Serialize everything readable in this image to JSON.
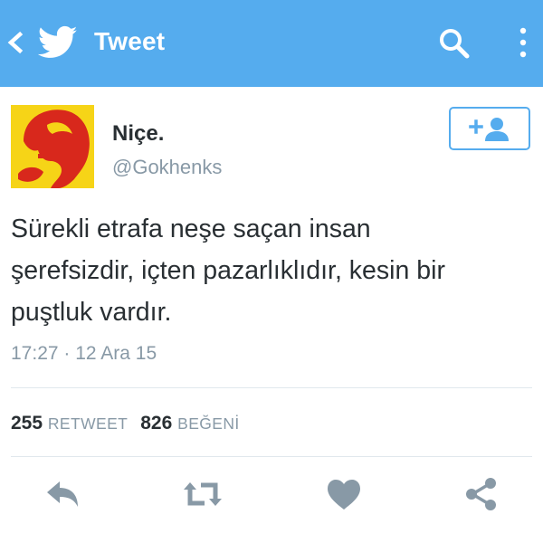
{
  "app_bar": {
    "title": "Tweet",
    "background": "#55acee",
    "icons": [
      "chevron-left-icon",
      "twitter-bird-icon",
      "search-icon",
      "overflow-menu-icon"
    ]
  },
  "author": {
    "name": "Niçe.",
    "handle": "@Gokhenks",
    "avatar_colors": {
      "background": "#f6d417",
      "figure": "#d8281c"
    }
  },
  "follow_button": {
    "icon": "follow-user-icon",
    "color": "#55acee"
  },
  "tweet": {
    "lines": [
      "Sürekli etrafa neşe saçan insan",
      "şerefsizdir, içten pazarlıklıdır, kesin bir",
      "puştluk vardır."
    ],
    "timestamp": "17:27 · 12 Ara 15"
  },
  "stats": {
    "retweet_count": "255",
    "retweet_label": "RETWEET",
    "like_count": "826",
    "like_label": "BEĞENİ"
  },
  "actions": [
    "reply-icon",
    "retweet-icon",
    "like-heart-icon",
    "share-icon"
  ],
  "colors": {
    "text": "#292f33",
    "secondary": "#8899a6",
    "divider": "#e1e8ed",
    "action_icon": "#8899a6"
  }
}
